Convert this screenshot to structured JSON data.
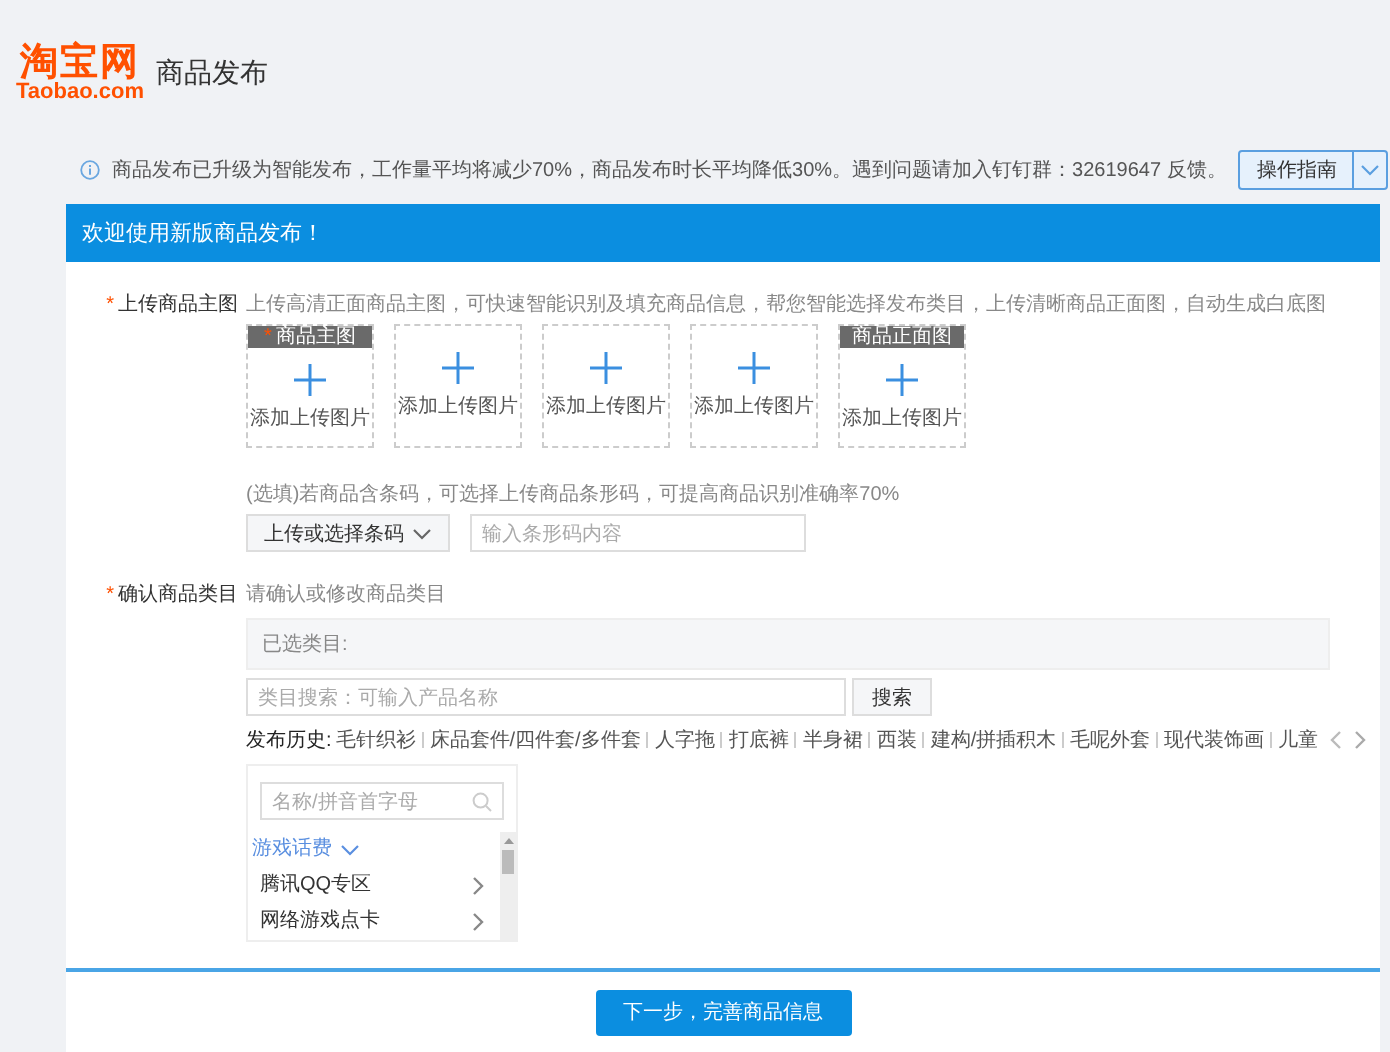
{
  "header": {
    "logo": {
      "name": "淘宝网",
      "domain": "Taobao.com"
    },
    "title": "商品发布"
  },
  "notice": {
    "text": "商品发布已升级为智能发布，工作量平均将减少70%，商品发布时长平均降低30%。遇到问题请加入钉钉群：32619647 反馈。",
    "guide_button": "操作指南"
  },
  "panel": {
    "title": "欢迎使用新版商品发布！"
  },
  "main_image": {
    "marker": "*",
    "label": "上传商品主图",
    "hint": "上传高清正面商品主图，可快速智能识别及填充商品信息，帮您智能选择发布类目，上传清晰商品正面图，自动生成白底图",
    "slots": [
      {
        "header": "商品主图",
        "marker": "*",
        "label": "添加上传图片"
      },
      {
        "label": "添加上传图片"
      },
      {
        "label": "添加上传图片"
      },
      {
        "label": "添加上传图片"
      },
      {
        "header": "商品正面图",
        "label": "添加上传图片"
      }
    ],
    "barcode": {
      "hint": "(选填)若商品含条码，可选择上传商品条形码，可提高商品识别准确率70%",
      "dropdown": "上传或选择条码",
      "placeholder": "输入条形码内容"
    }
  },
  "category": {
    "marker": "*",
    "label": "确认商品类目",
    "hint": "请确认或修改商品类目",
    "selected_label": "已选类目:",
    "search_placeholder": "类目搜索：可输入产品名称",
    "search_button": "搜索",
    "history_label": "发布历史:",
    "history": [
      "毛针织衫",
      "床品套件/四件套/多件套",
      "人字拖",
      "打底裤",
      "半身裙",
      "西装",
      "建构/拼插积木",
      "毛呢外套",
      "现代装饰画",
      "儿童"
    ],
    "tree": {
      "placeholder": "名称/拼音首字母",
      "groups": [
        {
          "name": "游戏话费",
          "expanded": true,
          "children": [
            {
              "name": "腾讯QQ专区"
            },
            {
              "name": "网络游戏点卡"
            }
          ]
        }
      ]
    }
  },
  "footer": {
    "next_button": "下一步，完善商品信息"
  }
}
